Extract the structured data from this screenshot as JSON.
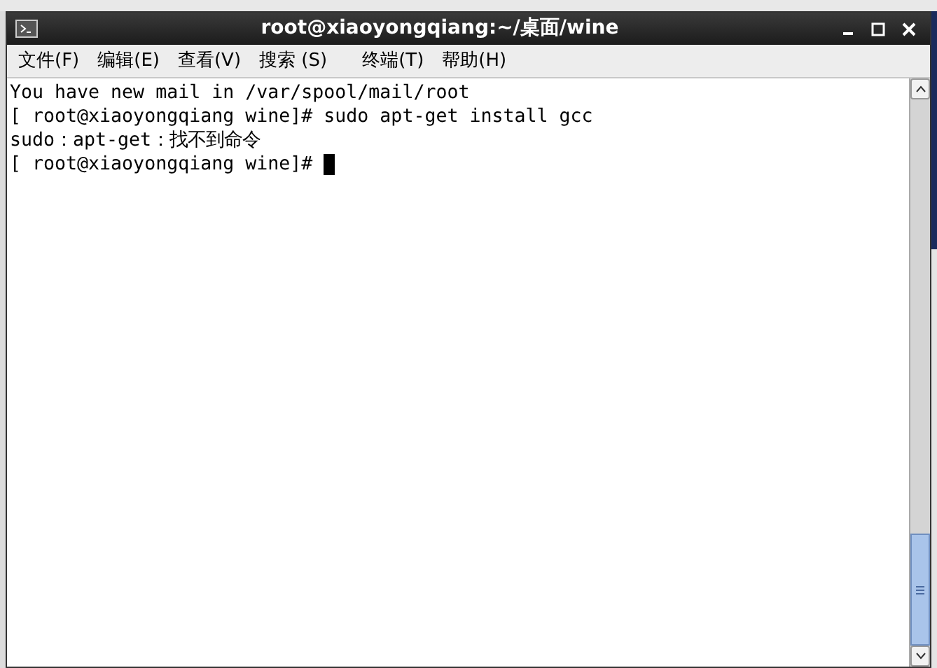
{
  "window": {
    "title": "root@xiaoyongqiang:~/桌面/wine"
  },
  "menu": [
    "文件(F)",
    "编辑(E)",
    "查看(V)",
    "搜索 (S)",
    "终端(T)",
    "帮助(H)"
  ],
  "terminal": {
    "lines": [
      {
        "text": "You have new mail in /var/spool/mail/root",
        "cursor": false
      },
      {
        "text": "[ root@xiaoyongqiang wine]# sudo apt-get install gcc",
        "cursor": false
      },
      {
        "text": "sudo：apt-get：找不到命令",
        "cursor": false
      },
      {
        "text": "[ root@xiaoyongqiang wine]# ",
        "cursor": true
      }
    ]
  }
}
